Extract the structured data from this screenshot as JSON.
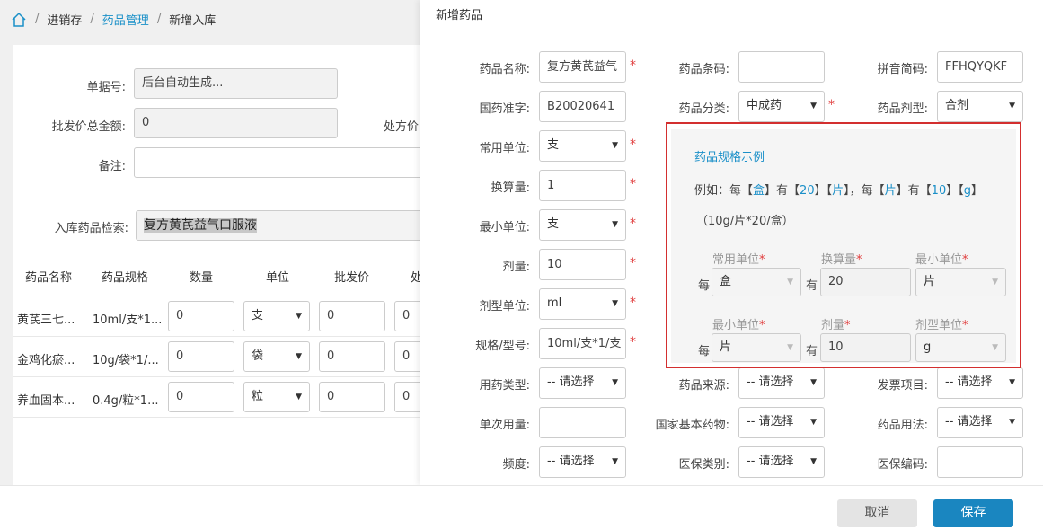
{
  "breadcrumb": {
    "level1": "进销存",
    "level2": "药品管理",
    "level3": "新增入库"
  },
  "left_form": {
    "doc_no_label": "单据号:",
    "doc_no_value": "后台自动生成...",
    "wholesale_total_label": "批发价总金额:",
    "wholesale_total_value": "0",
    "prescription_label": "处方价",
    "remark_label": "备注:",
    "search_label": "入库药品检索:",
    "search_value": "复方黄芪益气口服液"
  },
  "table": {
    "headers": [
      "药品名称",
      "药品规格",
      "数量",
      "单位",
      "批发价",
      "处"
    ],
    "rows": [
      {
        "name": "黄芪三七...",
        "spec": "10ml/支*1...",
        "qty": "0",
        "unit": "支",
        "price": "0",
        "extra": "0"
      },
      {
        "name": "金鸡化瘀...",
        "spec": "10g/袋*1/...",
        "qty": "0",
        "unit": "袋",
        "price": "0",
        "extra": "0"
      },
      {
        "name": "养血固本...",
        "spec": "0.4g/粒*1...",
        "qty": "0",
        "unit": "粒",
        "price": "0",
        "extra": "0"
      }
    ]
  },
  "modal": {
    "title": "新增药品",
    "drug_name_label": "药品名称:",
    "drug_name_value": "复方黄芪益气",
    "barcode_label": "药品条码:",
    "barcode_value": "",
    "pinyin_label": "拼音简码:",
    "pinyin_value": "FFHQYQKF",
    "approval_label": "国药准字:",
    "approval_value": "B20020641",
    "category_label": "药品分类:",
    "category_value": "中成药",
    "dosage_form_label": "药品剂型:",
    "dosage_form_value": "合剂",
    "common_unit_label": "常用单位:",
    "common_unit_value": "支",
    "conversion_label": "换算量:",
    "conversion_value": "1",
    "min_unit_label": "最小单位:",
    "min_unit_value": "支",
    "dose_label": "剂量:",
    "dose_value": "10",
    "dose_unit_label": "剂型单位:",
    "dose_unit_value": "ml",
    "spec_label": "规格/型号:",
    "spec_value": "10ml/支*1/支",
    "usage_type_label": "用药类型:",
    "usage_type_value": "-- 请选择",
    "source_label": "药品来源:",
    "source_value": "-- 请选择",
    "invoice_label": "发票项目:",
    "invoice_value": "-- 请选择",
    "single_dose_label": "单次用量:",
    "single_dose_value": "",
    "essential_label": "国家基本药物:",
    "essential_value": "-- 请选择",
    "usage_label": "药品用法:",
    "usage_value": "-- 请选择",
    "freq_label": "频度:",
    "freq_value": "-- 请选择",
    "insurance_type_label": "医保类别:",
    "insurance_type_value": "-- 请选择",
    "insurance_code_label": "医保编码:",
    "insurance_code_value": ""
  },
  "example": {
    "title": "药品规格示例",
    "line1_prefix": "例如：每【",
    "line1_u1": "盒",
    "line1_mid1": "】有【",
    "line1_n1": "20",
    "line1_mid2": "】【",
    "line1_u2": "片",
    "line1_mid3": "】，每【",
    "line1_u3": "片",
    "line1_mid4": "】有【",
    "line1_n2": "10",
    "line1_mid5": "】【",
    "line1_u4": "g",
    "line1_end": "】",
    "line2": "（10g/片*20/盒）",
    "row1": {
      "h1": "常用单位",
      "h2": "换算量",
      "h3": "最小单位",
      "each": "每",
      "v1": "盒",
      "has": "有",
      "v2": "20",
      "v3": "片"
    },
    "row2": {
      "h1": "最小单位",
      "h2": "剂量",
      "h3": "剂型单位",
      "each": "每",
      "v1": "片",
      "has": "有",
      "v2": "10",
      "v3": "g"
    },
    "star": "*"
  },
  "buttons": {
    "cancel": "取消",
    "save": "保存"
  },
  "colors": {
    "accent": "#1a90c8",
    "required": "#e03a3a",
    "highlight_border": "#d32f2f"
  }
}
